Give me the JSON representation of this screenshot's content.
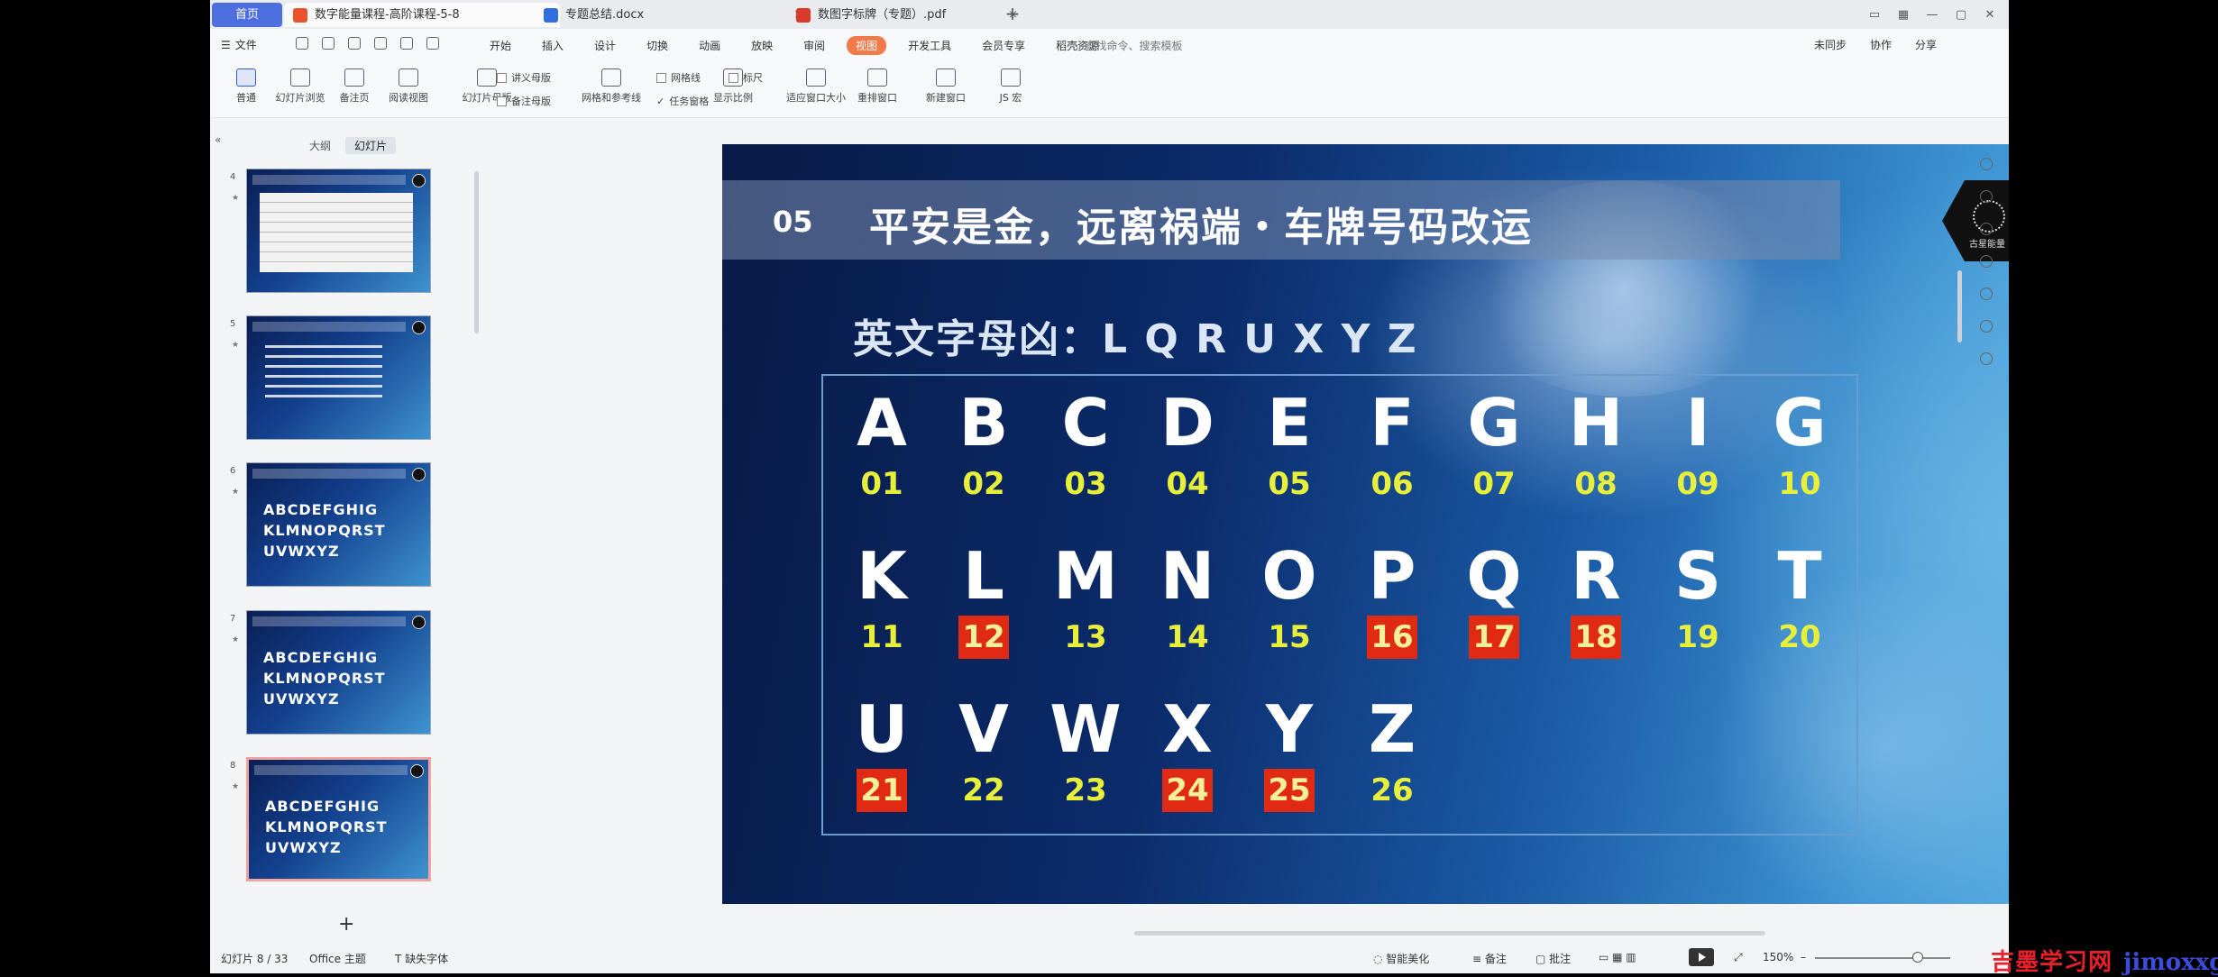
{
  "tabs": {
    "home": "首页",
    "items": [
      {
        "label": "数字能量课程-高阶课程-5-8",
        "color": "#e8532b",
        "active": true
      },
      {
        "label": "专题总结.docx",
        "color": "#2f6fe0",
        "active": false
      },
      {
        "label": "数图字标牌（专题）.pdf",
        "color": "#d93a2b",
        "active": false
      }
    ]
  },
  "menu": {
    "file": "文件",
    "items": [
      "开始",
      "插入",
      "设计",
      "切换",
      "动画",
      "放映",
      "审阅",
      "视图",
      "开发工具",
      "会员专享",
      "稻壳资源"
    ],
    "active_index": 7,
    "search": "查找命令、搜索模板",
    "right_actions": [
      "未同步",
      "协作",
      "分享"
    ]
  },
  "ribbon": {
    "buttons": [
      {
        "label": "普通",
        "selected": true
      },
      {
        "label": "幻灯片浏览"
      },
      {
        "label": "备注页"
      },
      {
        "label": "阅读视图"
      },
      {
        "label": "幻灯片母版"
      },
      {
        "label": "网格和参考线"
      },
      {
        "label": "显示比例"
      },
      {
        "label": "适应窗口大小"
      },
      {
        "label": "重排窗口"
      },
      {
        "label": "新建窗口"
      },
      {
        "label": "JS 宏"
      }
    ],
    "small": [
      "讲义母版",
      "备注母版",
      "网格线",
      "标尺",
      "任务窗格"
    ]
  },
  "panel": {
    "tabs": [
      "大纲",
      "幻灯片"
    ],
    "active_tab": 1,
    "thumb_numbers": [
      "4",
      "5",
      "6",
      "7",
      "8"
    ],
    "thumb_letters": [
      "ABCDEFGHIG",
      "KLMNOPQRST",
      "UVWXYZ"
    ]
  },
  "slide": {
    "number": "05",
    "title": "平安是金，远离祸端・车牌号码改运",
    "subtitle": "英文字母凶：L Q R U X Y Z",
    "logo_text": "古星能量",
    "letters": [
      {
        "l": "A",
        "n": "01",
        "bad": false
      },
      {
        "l": "B",
        "n": "02",
        "bad": false
      },
      {
        "l": "C",
        "n": "03",
        "bad": false
      },
      {
        "l": "D",
        "n": "04",
        "bad": false
      },
      {
        "l": "E",
        "n": "05",
        "bad": false
      },
      {
        "l": "F",
        "n": "06",
        "bad": false
      },
      {
        "l": "G",
        "n": "07",
        "bad": false
      },
      {
        "l": "H",
        "n": "08",
        "bad": false
      },
      {
        "l": "I",
        "n": "09",
        "bad": false
      },
      {
        "l": "G",
        "n": "10",
        "bad": false
      },
      {
        "l": "K",
        "n": "11",
        "bad": false
      },
      {
        "l": "L",
        "n": "12",
        "bad": true
      },
      {
        "l": "M",
        "n": "13",
        "bad": false
      },
      {
        "l": "N",
        "n": "14",
        "bad": false
      },
      {
        "l": "O",
        "n": "15",
        "bad": false
      },
      {
        "l": "P",
        "n": "16",
        "bad": true
      },
      {
        "l": "Q",
        "n": "17",
        "bad": true
      },
      {
        "l": "R",
        "n": "18",
        "bad": true
      },
      {
        "l": "S",
        "n": "19",
        "bad": false
      },
      {
        "l": "T",
        "n": "20",
        "bad": false
      },
      {
        "l": "U",
        "n": "21",
        "bad": true
      },
      {
        "l": "V",
        "n": "22",
        "bad": false
      },
      {
        "l": "W",
        "n": "23",
        "bad": false
      },
      {
        "l": "X",
        "n": "24",
        "bad": true
      },
      {
        "l": "Y",
        "n": "25",
        "bad": true
      },
      {
        "l": "Z",
        "n": "26",
        "bad": false
      }
    ]
  },
  "status": {
    "slide_info": "幻灯片 8 / 33",
    "theme": "Office 主题",
    "font": "缺失字体",
    "beautify": "智能美化",
    "notes": "备注",
    "comments": "批注",
    "zoom": "150%"
  },
  "watermark": {
    "cn": "吉墨学习网",
    "en": "jimoxxg.com"
  },
  "colors": {
    "accent": "#f07a4a",
    "bad_number_bg": "#e12a14",
    "number_text": "#e8ef3a",
    "home_tab": "#4d6fe0"
  }
}
